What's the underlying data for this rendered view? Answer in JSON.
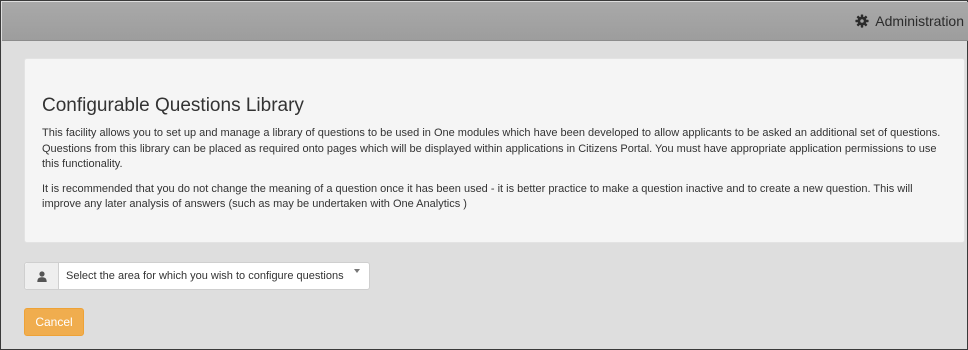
{
  "header": {
    "admin_label": "Administration",
    "admin_icon": "gear-icon"
  },
  "main": {
    "title": "Configurable Questions Library",
    "paragraphs": [
      "This facility allows you to set up and manage a library of questions to be used in One modules which have been developed to allow applicants to be asked an additional set of questions. Questions from this library can be placed as required onto pages which will be displayed within applications in Citizens Portal. You must have appropriate application permissions to use this functionality.",
      "It is recommended that you do not change the meaning of a question once it has been used - it is better practice to make a question inactive and to create a new question. This will improve any later analysis of answers (such as may be undertaken with One Analytics )"
    ]
  },
  "area_select": {
    "icon": "user-icon",
    "selected": "Select the area for which you wish to configure questions"
  },
  "actions": {
    "cancel_label": "Cancel"
  },
  "colors": {
    "topbar": "#a3a3a3",
    "background": "#dedede",
    "panel": "#f5f5f5",
    "cancel": "#f0ad4e"
  }
}
